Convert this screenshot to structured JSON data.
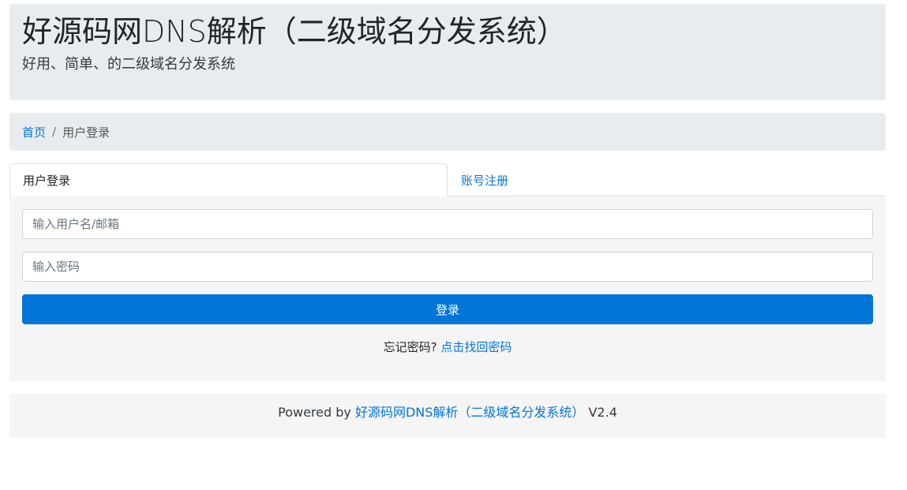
{
  "header": {
    "title": "好源码网DNS解析（二级域名分发系统）",
    "subtitle": "好用、简单、的二级域名分发系统"
  },
  "breadcrumb": {
    "home": "首页",
    "separator": "/",
    "current": "用户登录"
  },
  "tabs": [
    {
      "label": "用户登录",
      "active": true
    },
    {
      "label": "账号注册",
      "active": false
    }
  ],
  "login": {
    "username_placeholder": "输入用户名/邮箱",
    "username_value": "",
    "password_placeholder": "输入密码",
    "password_value": "",
    "submit_label": "登录",
    "forgot_text": "忘记密码?",
    "forgot_link": "点击找回密码"
  },
  "footer": {
    "prefix": "Powered by",
    "link": "好源码网DNS解析（二级域名分发系统）",
    "version": "V2.4"
  },
  "colors": {
    "primary": "#0275d8",
    "jumbotron_bg": "#e9ecef",
    "panel_bg": "#f5f5f5"
  }
}
